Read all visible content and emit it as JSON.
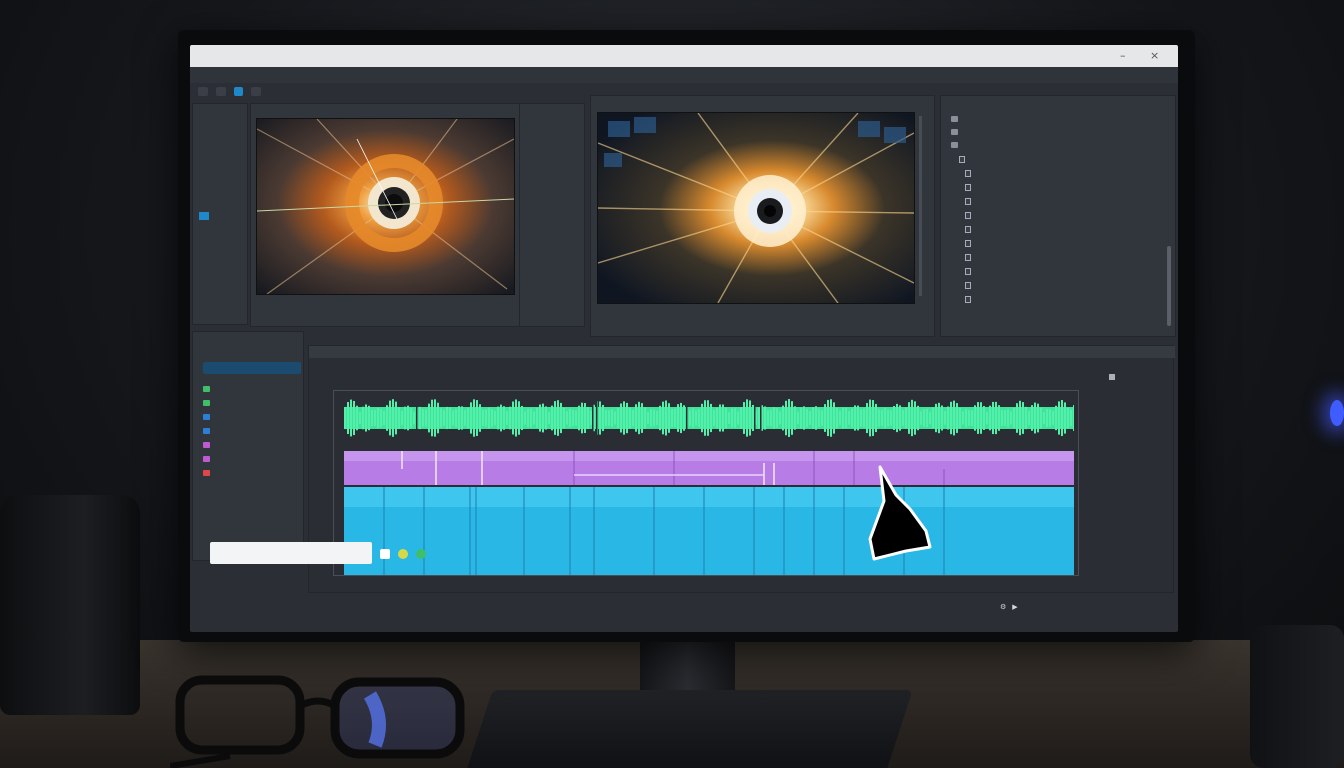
{
  "colors": {
    "accent": "#1e88c8",
    "audio_waveform": "#3fe39a",
    "video_track_purple": "#b87ce6",
    "video_track_cyan": "#29b8e6"
  },
  "icons": [
    "close-icon",
    "maximize-icon",
    "minimize-icon",
    "folder-icon",
    "file-icon",
    "play-icon",
    "settings-icon",
    "cursor-icon"
  ]
}
